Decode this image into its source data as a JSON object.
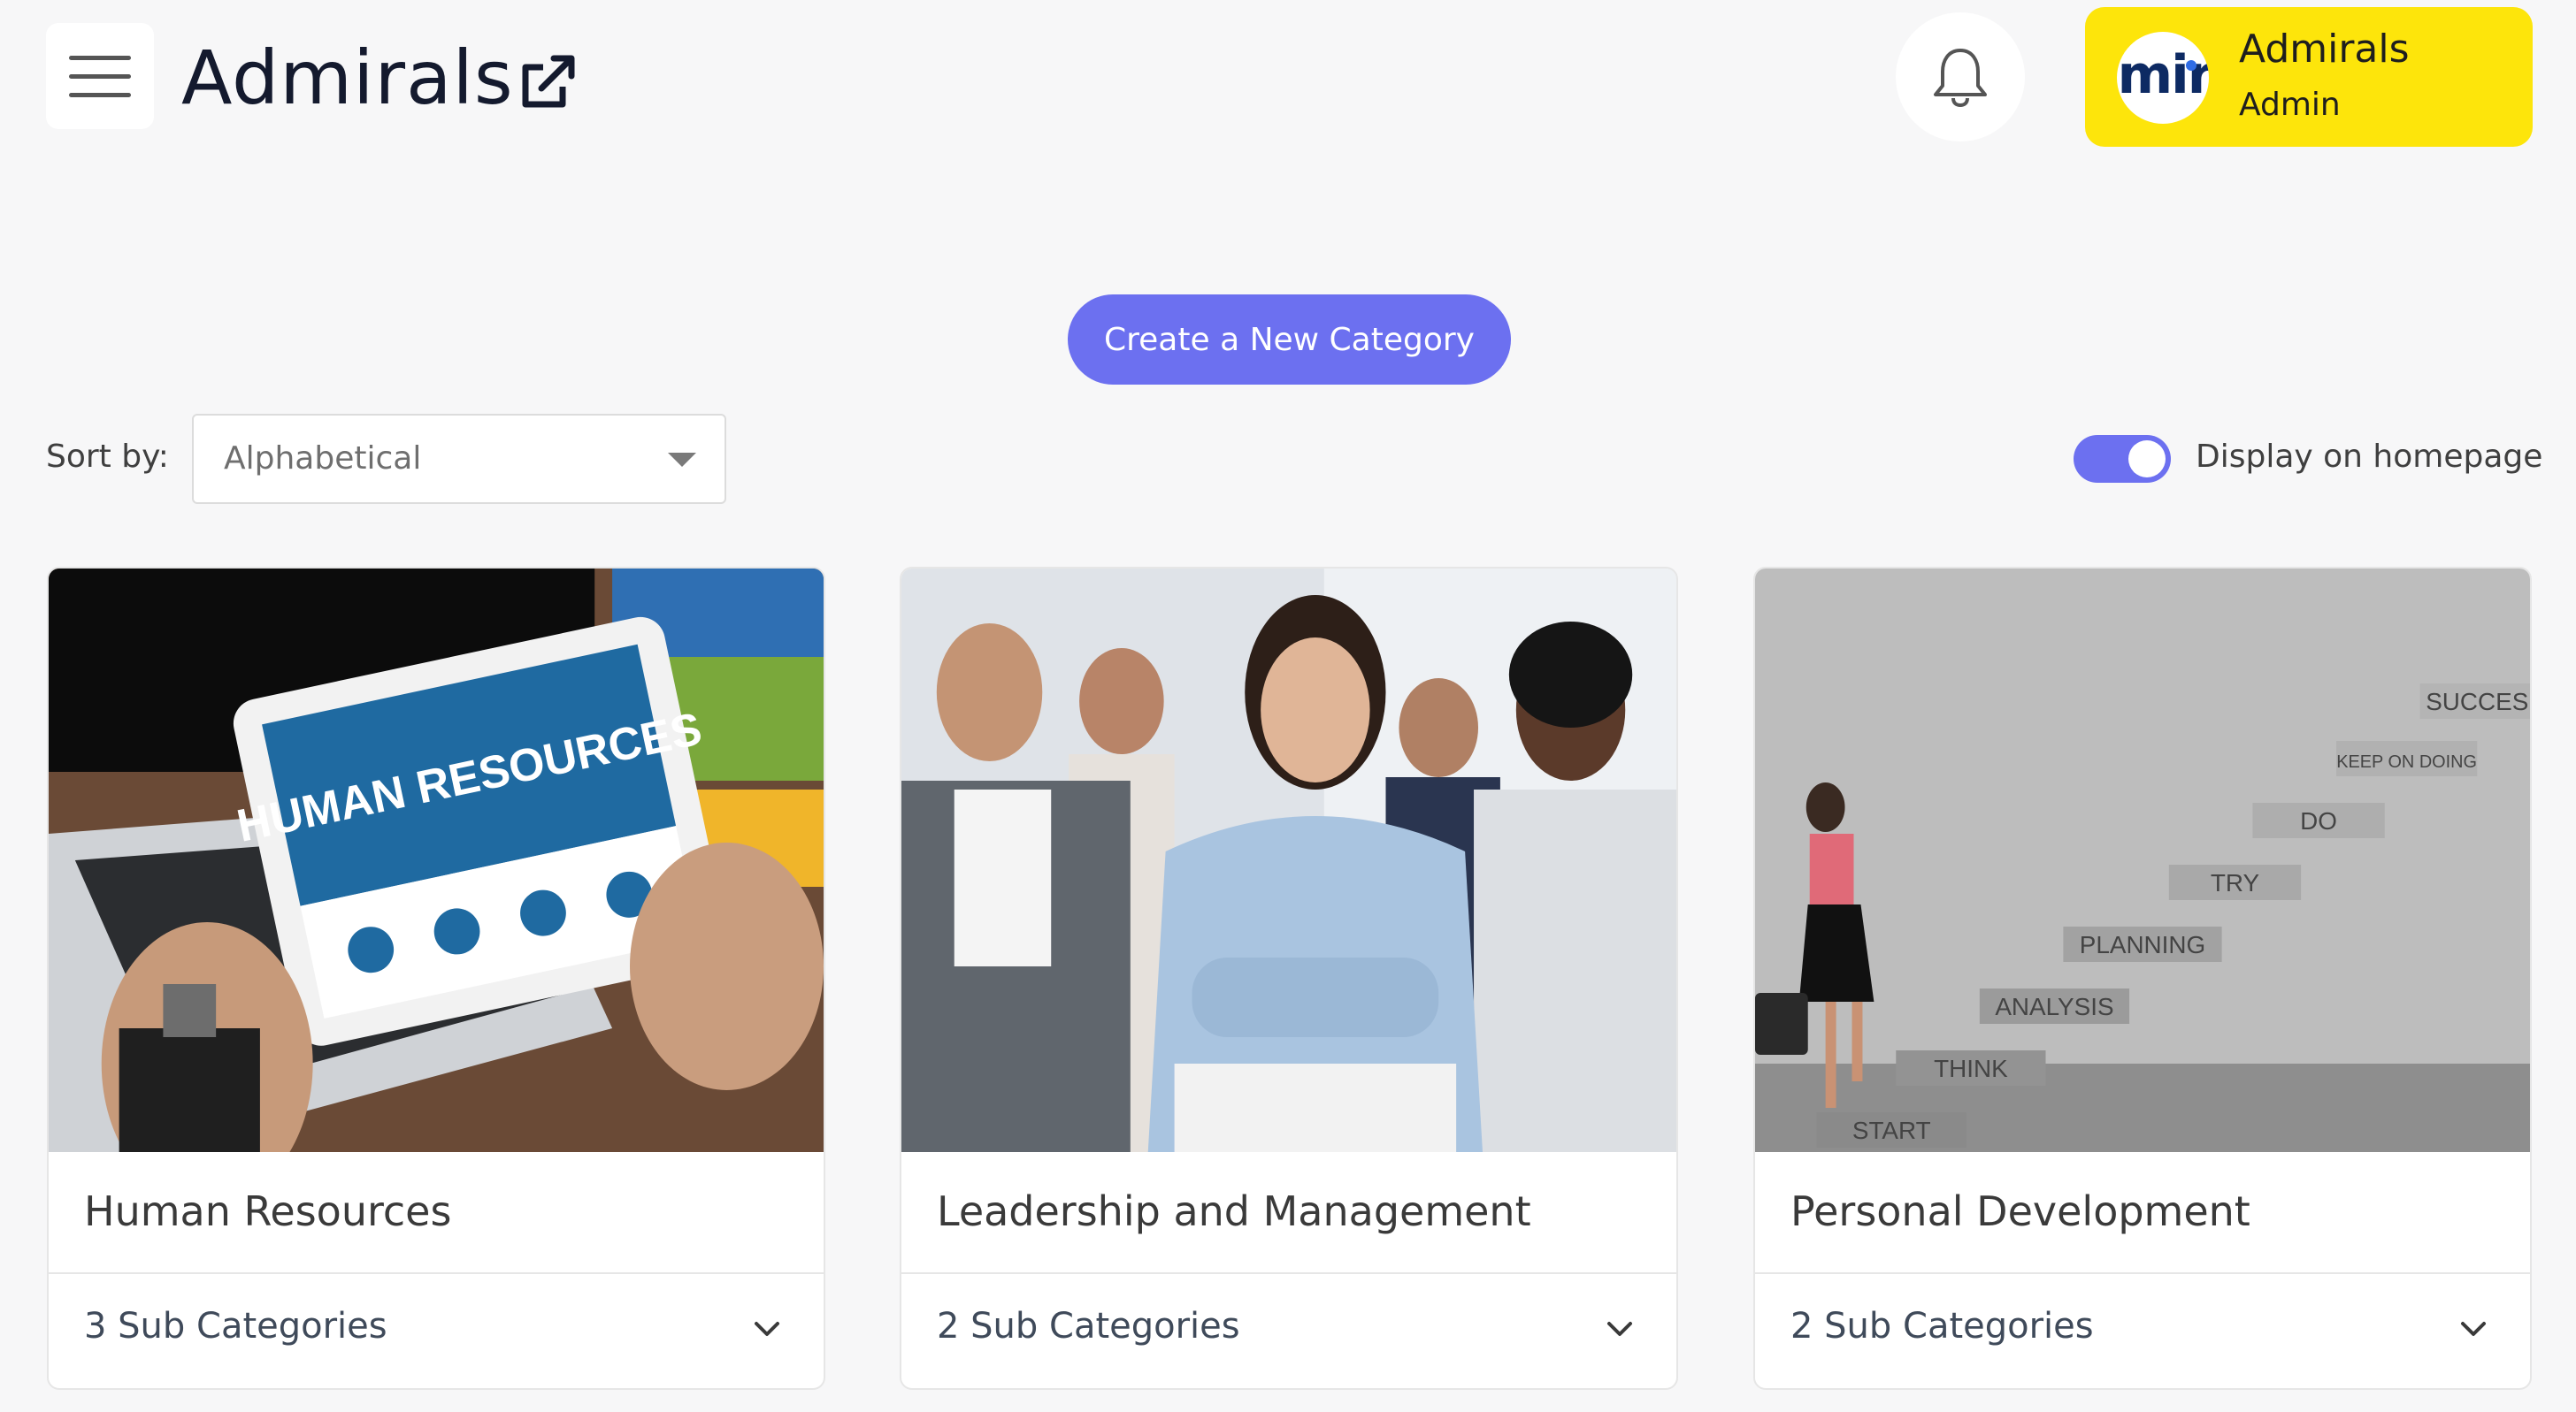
{
  "header": {
    "title": "Admirals",
    "menu_icon": "hamburger-icon",
    "external_link_icon": "external-link-icon",
    "notification_icon": "bell-icon"
  },
  "profile": {
    "avatar_text": "mir",
    "name": "Admirals",
    "role": "Admin",
    "background_color": "#fde50b"
  },
  "actions": {
    "create_label": "Create a New Category",
    "sort_label": "Sort by:",
    "sort_value": "Alphabetical",
    "toggle_label": "Display on homepage",
    "toggle_on": true,
    "accent_color": "#6c70f0"
  },
  "categories": [
    {
      "title": "Human Resources",
      "subcategories": "3 Sub Categories",
      "image_text": "HUMAN RESOURCES"
    },
    {
      "title": "Leadership and Management",
      "subcategories": "2 Sub Categories"
    },
    {
      "title": "Personal Development",
      "subcategories": "2 Sub Categories",
      "image_steps": [
        "START",
        "THINK",
        "ANALYSIS",
        "PLANNING",
        "TRY",
        "DO",
        "KEEP ON DOING",
        "SUCCES"
      ]
    }
  ]
}
